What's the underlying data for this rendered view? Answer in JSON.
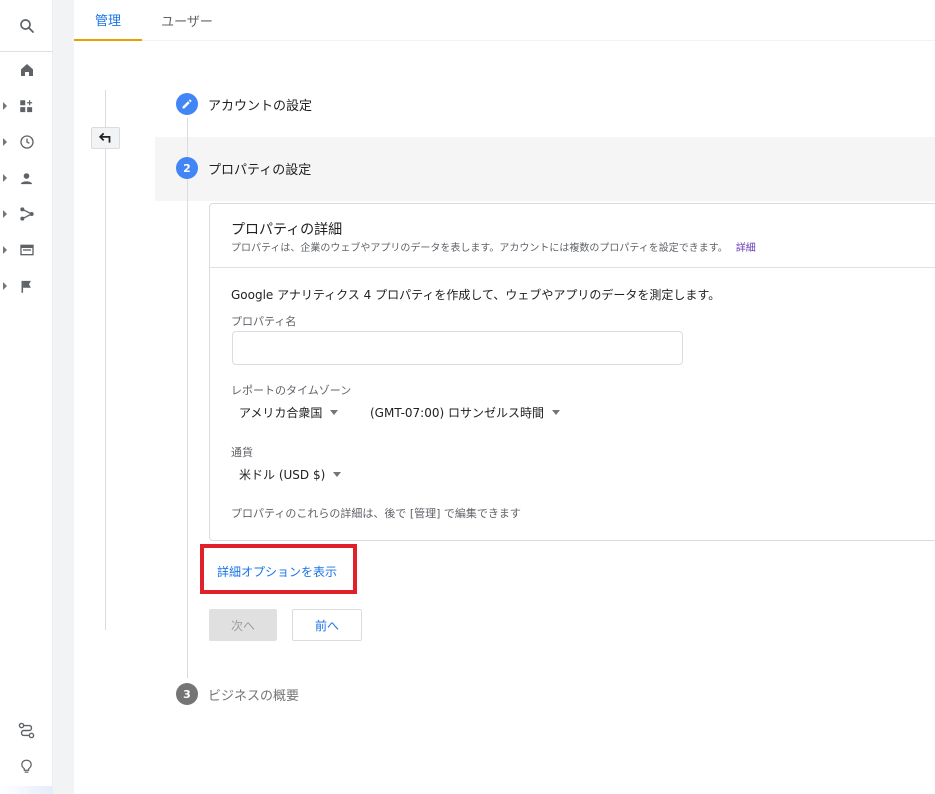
{
  "tabs": {
    "admin": "管理",
    "user": "ユーザー"
  },
  "rail": {
    "icons": [
      "search-icon",
      "home-icon",
      "dashboard-icon",
      "clock-icon",
      "person-icon",
      "acquisition-icon",
      "display-icon",
      "flag-icon",
      "route-icon",
      "lightbulb-icon"
    ]
  },
  "steps": [
    {
      "label": "アカウントの設定",
      "state": "done"
    },
    {
      "number": "2",
      "label": "プロパティの設定",
      "state": "active"
    },
    {
      "number": "3",
      "label": "ビジネスの概要",
      "state": "pending"
    }
  ],
  "card": {
    "title": "プロパティの詳細",
    "description": "プロパティは、企業のウェブやアプリのデータを表します。アカウントには複数のプロパティを設定できます。",
    "description_link": "詳細",
    "intro": "Google アナリティクス 4 プロパティを作成して、ウェブやアプリのデータを測定します。",
    "property_name_label": "プロパティ名",
    "property_name_value": "",
    "timezone_label": "レポートのタイムゾーン",
    "country": "アメリカ合衆国",
    "timezone": "(GMT-07:00) ロサンゼルス時間",
    "currency_label": "通貨",
    "currency": "米ドル (USD $)",
    "note": "プロパティのこれらの詳細は、後で [管理] で編集できます"
  },
  "advanced_options_link": "詳細オプションを表示",
  "buttons": {
    "next": "次へ",
    "prev": "前へ"
  },
  "colors": {
    "accent": "#1a73e8",
    "step_active": "#4285f4",
    "step_pending": "#757575",
    "highlight": "#e0202a",
    "tab_indicator": "#e8a000"
  }
}
